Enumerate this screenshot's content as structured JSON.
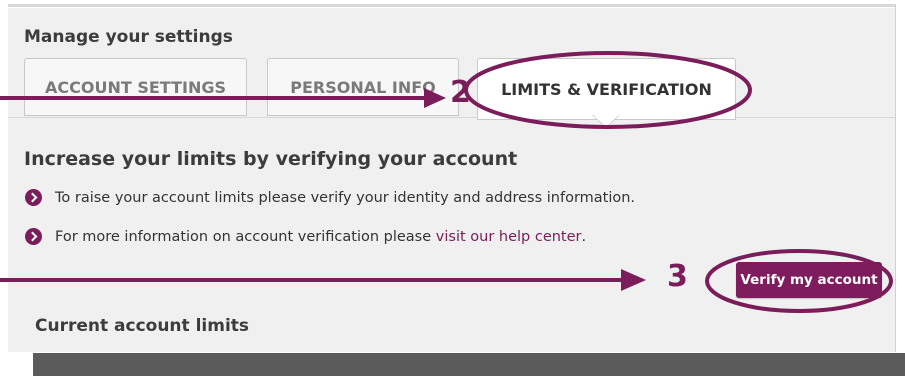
{
  "settings": {
    "heading": "Manage your settings",
    "tabs": [
      {
        "label": "ACCOUNT SETTINGS"
      },
      {
        "label": "PERSONAL INFO"
      },
      {
        "label": "LIMITS & VERIFICATION"
      }
    ]
  },
  "verification": {
    "heading": "Increase your limits by verifying your account",
    "bullet1": "To raise your account limits please verify your identity and address information.",
    "bullet2_prefix": "For more information on account verification please ",
    "bullet2_link": "visit our help center",
    "bullet2_suffix": ".",
    "button_label": "Verify my account"
  },
  "limits": {
    "heading": "Current account limits"
  },
  "annotations": {
    "step2": "2",
    "step3": "3"
  },
  "colors": {
    "accent": "#7a1d5a",
    "panel_bg": "#f0f0f0"
  }
}
